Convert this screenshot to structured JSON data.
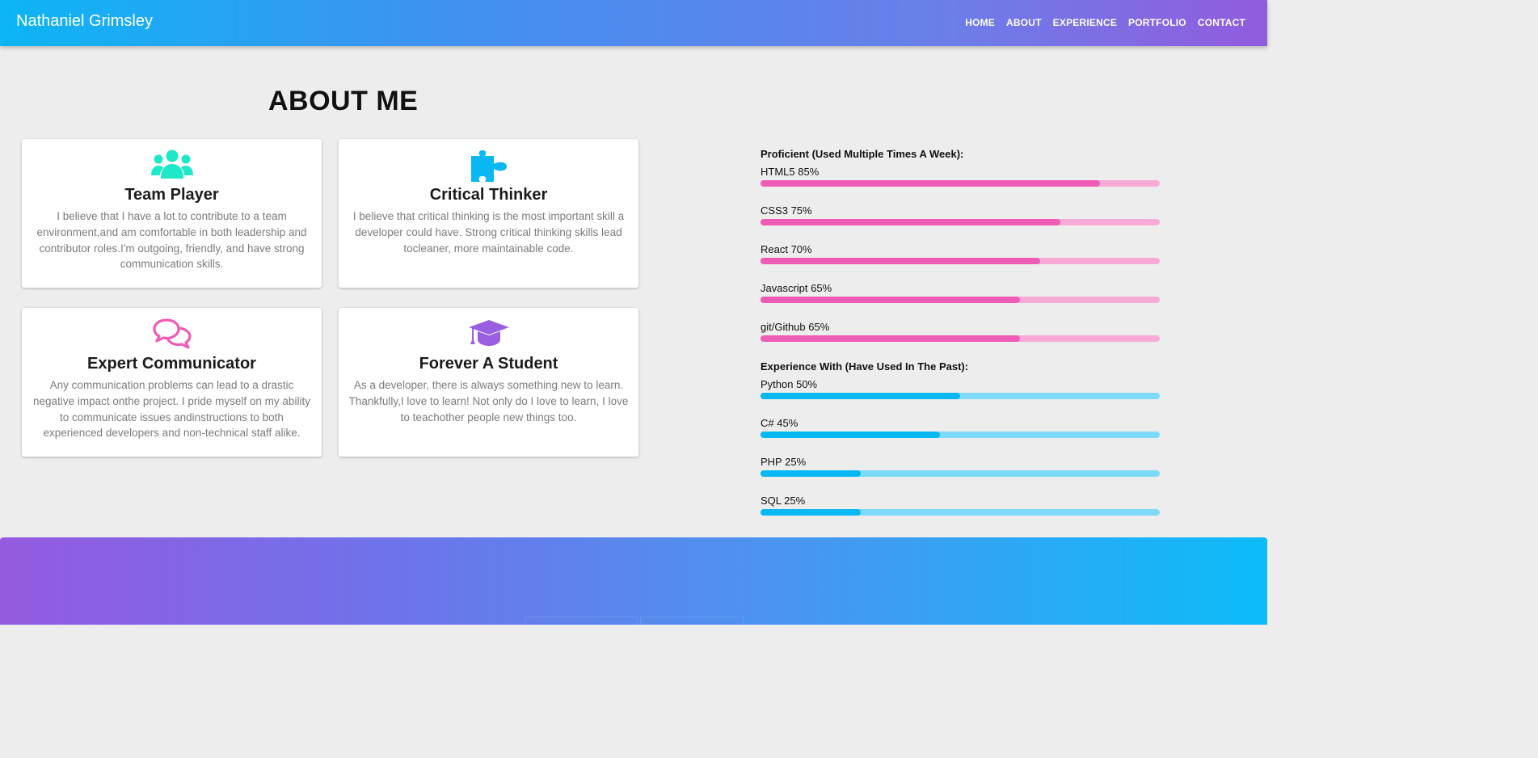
{
  "header": {
    "brand": "Nathaniel Grimsley",
    "nav": [
      "HOME",
      "ABOUT",
      "EXPERIENCE",
      "PORTFOLIO",
      "CONTACT"
    ]
  },
  "about": {
    "title": "ABOUT ME",
    "cards": [
      {
        "icon": "users-icon",
        "icon_color": "#1de9c8",
        "title": "Team Player",
        "text": "I believe that I have a lot to contribute to a team environment,and am comfortable in both leadership and contributor roles.I'm outgoing, friendly, and have strong communication skills."
      },
      {
        "icon": "puzzle-piece-icon",
        "icon_color": "#08b8f2",
        "title": "Critical Thinker",
        "text": "I believe that critical thinking is the most important skill a developer could have. Strong critical thinking skills lead tocleaner, more maintainable code."
      },
      {
        "icon": "comments-icon",
        "icon_color": "#ef5cb5",
        "title": "Expert Communicator",
        "text": "Any communication problems can lead to a drastic negative impact onthe project. I pride myself on my ability to communicate issues andinstructions to both experienced developers and non-technical staff alike."
      },
      {
        "icon": "graduation-cap-icon",
        "icon_color": "#9a5fe0",
        "title": "Forever A Student",
        "text": "As a developer, there is always something new to learn. Thankfully,I love to learn! Not only do I love to learn, I love to teachother people new things too."
      }
    ]
  },
  "skills": {
    "proficient": {
      "heading": "Proficient (Used Multiple Times A Week):",
      "color": "#ef5cb5",
      "items": [
        {
          "label": "HTML5 85%",
          "value": 85
        },
        {
          "label": "CSS3 75%",
          "value": 75
        },
        {
          "label": "React 70%",
          "value": 70
        },
        {
          "label": "Javascript 65%",
          "value": 65
        },
        {
          "label": "git/Github 65%",
          "value": 65
        }
      ]
    },
    "experience": {
      "heading": "Experience With (Have Used In The Past):",
      "color": "#08b8f2",
      "items": [
        {
          "label": "Python 50%",
          "value": 50
        },
        {
          "label": "C# 45%",
          "value": 45
        },
        {
          "label": "PHP 25%",
          "value": 25
        },
        {
          "label": "SQL 25%",
          "value": 25
        }
      ]
    }
  }
}
